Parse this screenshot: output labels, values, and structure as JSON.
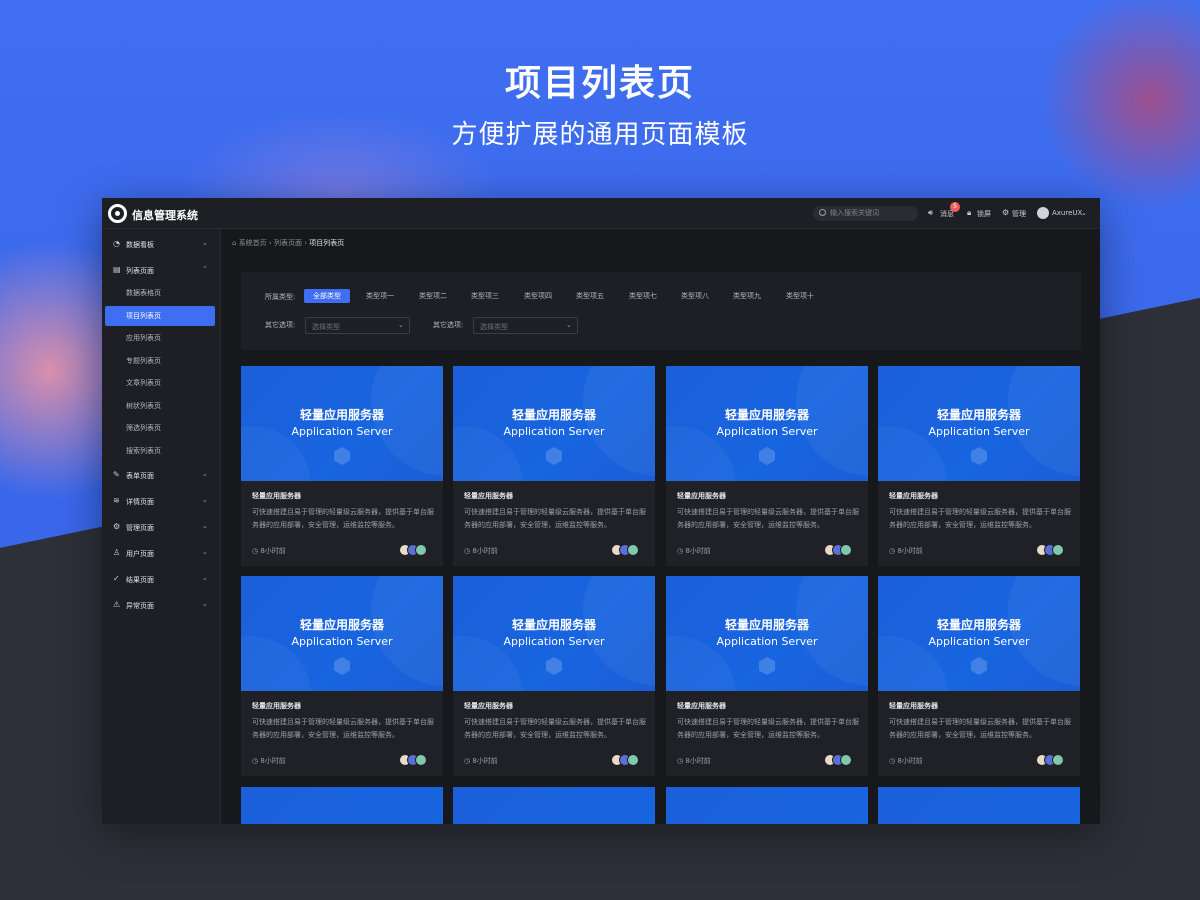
{
  "hero": {
    "title": "项目列表页",
    "subtitle": "方便扩展的通用页面模板"
  },
  "topbar": {
    "app_name": "信息管理系统",
    "search_placeholder": "输入搜索关键词",
    "messages_label": "消息",
    "messages_badge": "5",
    "lock_label": "锁屏",
    "admin_label": "管理",
    "user_name": "AxureUX"
  },
  "sidebar": {
    "groups": [
      {
        "label": "数据看板",
        "icon": "dashboard-icon"
      },
      {
        "label": "列表页面",
        "icon": "document-icon"
      },
      {
        "label": "表单页面",
        "icon": "edit-icon"
      },
      {
        "label": "详情页面",
        "icon": "layers-icon"
      },
      {
        "label": "管理页面",
        "icon": "gear-icon"
      },
      {
        "label": "用户页面",
        "icon": "user-icon"
      },
      {
        "label": "结果页面",
        "icon": "check-circle-icon"
      },
      {
        "label": "异常页面",
        "icon": "warning-icon"
      }
    ],
    "sub_items": [
      "数据表格页",
      "项目列表页",
      "应用列表页",
      "专题列表页",
      "文章列表页",
      "树状列表页",
      "筛选列表页",
      "搜索列表页"
    ],
    "active_sub": "项目列表页"
  },
  "breadcrumb": {
    "home": "系统首页",
    "parent": "列表页面",
    "current": "项目列表页"
  },
  "filters": {
    "type_label": "所属类型:",
    "types": [
      "全部类型",
      "类型项一",
      "类型项二",
      "类型项三",
      "类型项四",
      "类型项五",
      "类型项七",
      "类型项八",
      "类型项九",
      "类型项十"
    ],
    "active_type": "全部类型",
    "other_label_1": "其它选项:",
    "other_label_2": "其它选项:",
    "select_placeholder_1": "选择类型",
    "select_placeholder_2": "选择类型"
  },
  "card": {
    "image_title": "轻量应用服务器",
    "image_subtitle": "Application Server",
    "title": "轻量应用服务器",
    "description": "可快速搭建且易于管理的轻量级云服务器，提供基于单台服务器的应用部署，安全管理，运维监控等服务。",
    "time": "8小时前"
  },
  "colors": {
    "accent": "#3e6ef2",
    "card_blue": "#1865e0",
    "badge_red": "#f25b5b"
  }
}
